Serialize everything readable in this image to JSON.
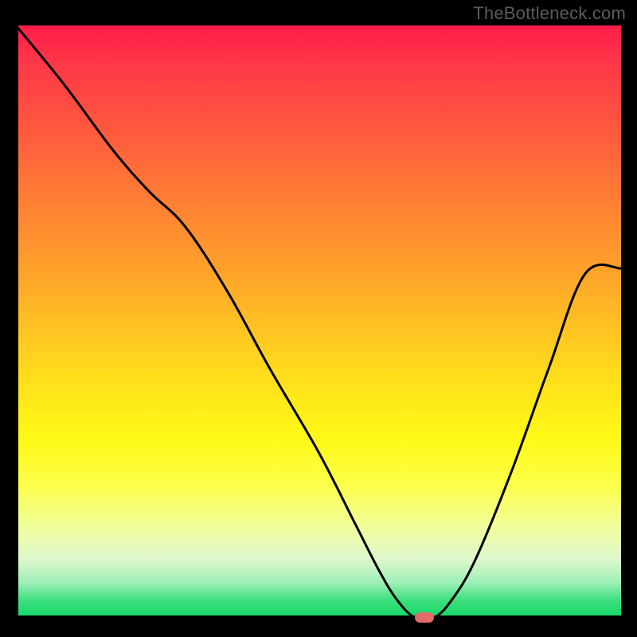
{
  "watermark": "TheBottleneck.com",
  "chart_data": {
    "type": "line",
    "title": "",
    "xlabel": "",
    "ylabel": "",
    "xlim": [
      0,
      100
    ],
    "ylim": [
      0,
      100
    ],
    "grid": false,
    "legend": false,
    "background": "rainbow-gradient vertical (red top → green bottom)",
    "series": [
      {
        "name": "curve",
        "x": [
          0,
          8,
          16,
          22,
          28,
          35,
          42,
          50,
          56,
          60,
          63,
          66,
          69,
          72,
          76,
          82,
          88,
          94,
          100
        ],
        "y": [
          100,
          90,
          79,
          72,
          66,
          55,
          42,
          28,
          16,
          8,
          3,
          0,
          0,
          3,
          10,
          25,
          42,
          58,
          59
        ]
      }
    ],
    "marker": {
      "name": "pill-marker",
      "x": 67.5,
      "y": 0,
      "color": "#e16a6a"
    }
  }
}
